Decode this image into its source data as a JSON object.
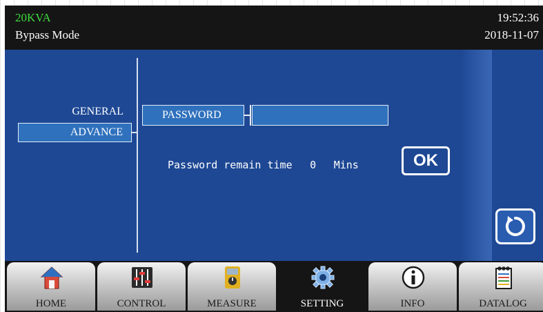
{
  "header": {
    "model": "20KVA",
    "mode": "Bypass Mode",
    "time": "19:52:36",
    "date": "2018-11-07"
  },
  "sidebar": {
    "items": [
      {
        "label": "GENERAL",
        "selected": false
      },
      {
        "label": "ADVANCE",
        "selected": true
      }
    ]
  },
  "password": {
    "label": "PASSWORD",
    "value": ""
  },
  "remain": {
    "label": "Password remain time",
    "value": "0",
    "unit": "Mins"
  },
  "buttons": {
    "ok_label": "OK"
  },
  "nav": {
    "tabs": [
      {
        "label": "HOME",
        "icon": "home-icon",
        "active": false
      },
      {
        "label": "CONTROL",
        "icon": "sliders-icon",
        "active": false
      },
      {
        "label": "MEASURE",
        "icon": "multimeter-icon",
        "active": false
      },
      {
        "label": "SETTING",
        "icon": "gear-icon",
        "active": true
      },
      {
        "label": "INFO",
        "icon": "info-icon",
        "active": false
      },
      {
        "label": "DATALOG",
        "icon": "notepad-icon",
        "active": false
      }
    ]
  },
  "colors": {
    "header_bg": "#151515",
    "model_text": "#3ddc3d",
    "panel_bg": "#1e4894",
    "selected_bg": "#2f71bd"
  }
}
